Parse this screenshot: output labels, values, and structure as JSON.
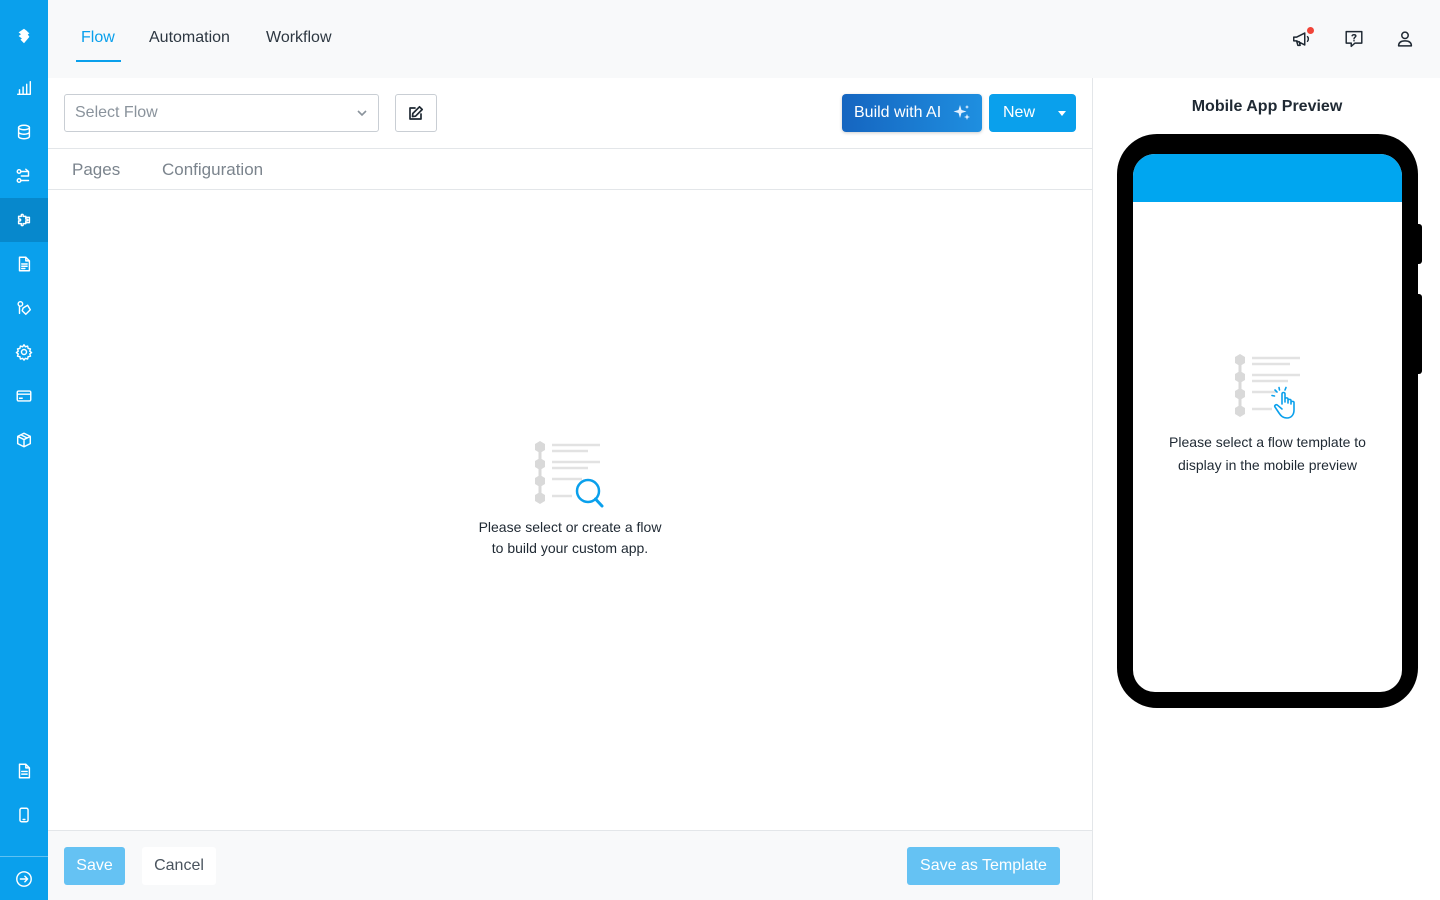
{
  "nav": {
    "tabs": [
      {
        "label": "Flow",
        "active": true
      },
      {
        "label": "Automation",
        "active": false
      },
      {
        "label": "Workflow",
        "active": false
      }
    ]
  },
  "sidebar": {
    "icons": [
      "logo-icon",
      "chart-icon",
      "database-icon",
      "flow-icon",
      "puzzle-icon",
      "document-icon",
      "pricetag-icon",
      "gear-icon",
      "credit-card-icon",
      "box-icon",
      "file-text-icon",
      "mobile-icon",
      "arrow-right-circle-icon"
    ],
    "active_icon": "puzzle-icon"
  },
  "topbar": {
    "icons": [
      "megaphone-icon",
      "help-chat-icon",
      "user-icon"
    ]
  },
  "toolbar": {
    "select_placeholder": "Select Flow",
    "ai_button_label": "Build with AI",
    "new_button_label": "New"
  },
  "subtabs": {
    "pages_label": "Pages",
    "configuration_label": "Configuration"
  },
  "empty_state": {
    "line1": "Please select or create a flow",
    "line2": "to build your custom app."
  },
  "footer": {
    "save_label": "Save",
    "cancel_label": "Cancel",
    "template_label": "Save as Template"
  },
  "preview": {
    "title": "Mobile App Preview",
    "line1": "Please select a flow template to",
    "line2": "display in the mobile preview"
  },
  "colors": {
    "accent": "#0aa0ec",
    "ai_gradient_start": "#1565c0",
    "ai_gradient_end": "#1f8fe0",
    "disabled_button": "#65c2f3",
    "phone_header": "#00a6f0",
    "notification": "#f04438"
  }
}
